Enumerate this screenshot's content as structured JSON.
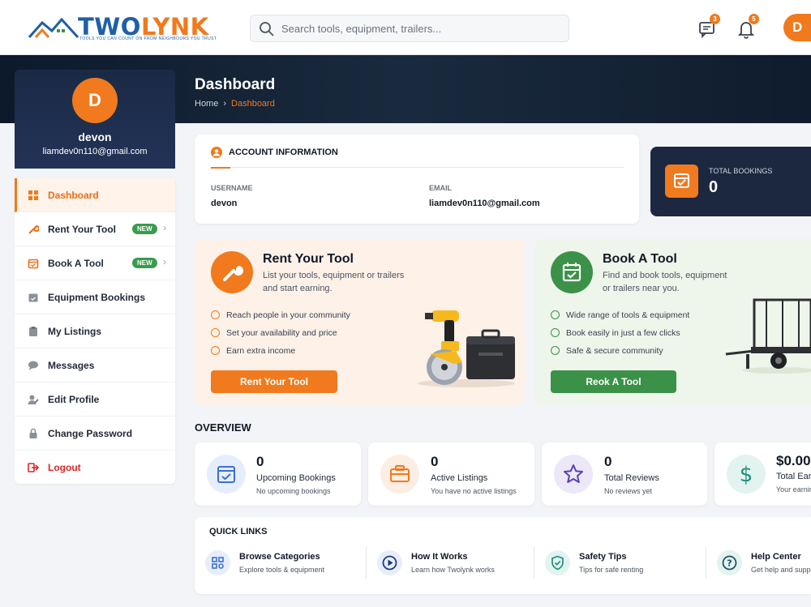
{
  "brand": {
    "name_part1": "TWO",
    "name_part2": "LYNK",
    "tagline": "TOOLS YOU CAN COUNT ON FROM NEIGHBOURS YOU TRUST"
  },
  "search": {
    "placeholder": "Search tools, equipment, trailers..."
  },
  "header": {
    "messages_count": "3",
    "notifications_count": "5",
    "avatar_letter": "D"
  },
  "page": {
    "title": "Dashboard",
    "breadcrumb": [
      "Home",
      "Dashboard"
    ]
  },
  "profile": {
    "initial": "D",
    "name": "devon",
    "email": "liamdev0n110@gmail.com"
  },
  "sidebar": {
    "items": [
      {
        "label": "Dashboard",
        "icon": "grid-icon"
      },
      {
        "label": "Rent Your Tool",
        "icon": "wrench-icon",
        "badge": "NEW"
      },
      {
        "label": "Book A Tool",
        "icon": "calendar-icon",
        "badge": "NEW"
      },
      {
        "label": "Equipment Bookings",
        "icon": "calendar-check-icon"
      },
      {
        "label": "My Listings",
        "icon": "clipboard-icon"
      },
      {
        "label": "Messages",
        "icon": "chat-icon"
      },
      {
        "label": "Edit Profile",
        "icon": "user-edit-icon"
      },
      {
        "label": "Change Password",
        "icon": "lock-icon"
      },
      {
        "label": "Logout",
        "icon": "logout-icon"
      }
    ]
  },
  "account": {
    "title": "ACCOUNT INFORMATION",
    "username_label": "USERNAME",
    "username": "devon",
    "email_label": "EMAIL",
    "email": "liamdev0n110@gmail.com"
  },
  "total_bookings": {
    "label": "TOTAL BOOKINGS",
    "value": "0"
  },
  "rent_card": {
    "title": "Rent Your Tool",
    "desc_line1": "List your tools, equipment or trailers",
    "desc_line2": "and start earning.",
    "features": [
      "Reach people in your community",
      "Set your availability and price",
      "Earn extra income"
    ],
    "button": "Rent Your Tool"
  },
  "book_card": {
    "title": "Book A Tool",
    "desc_line1": "Find and book tools, equipment",
    "desc_line2": "or trailers near you.",
    "features": [
      "Wide range of tools & equipment",
      "Book easily in just a few clicks",
      "Safe & secure community"
    ],
    "button": "Reok A Tool"
  },
  "overview": {
    "title": "OVERVIEW",
    "stats": [
      {
        "value": "0",
        "label": "Upcoming Bookings",
        "sub": "No upcoming bookings",
        "color": "#3b6fd6"
      },
      {
        "value": "0",
        "label": "Active Listings",
        "sub": "You have no active listings",
        "color": "#f07a1d"
      },
      {
        "value": "0",
        "label": "Total Reviews",
        "sub": "No reviews yet",
        "color": "#5b3fb5"
      },
      {
        "value": "$0.00",
        "label": "Total Earnings",
        "sub": "Your earnings",
        "color": "#1f8f7e"
      }
    ]
  },
  "quick_links": {
    "title": "QUICK LINKS",
    "items": [
      {
        "label": "Browse Categories",
        "sub": "Explore tools & equipment"
      },
      {
        "label": "How It Works",
        "sub": "Learn how Twolynk works"
      },
      {
        "label": "Safety Tips",
        "sub": "Tips for safe renting"
      },
      {
        "label": "Help Center",
        "sub": "Get help and support"
      }
    ]
  },
  "colors": {
    "accent": "#f07a1d",
    "green": "#3c9148",
    "navy": "#1c2740"
  }
}
